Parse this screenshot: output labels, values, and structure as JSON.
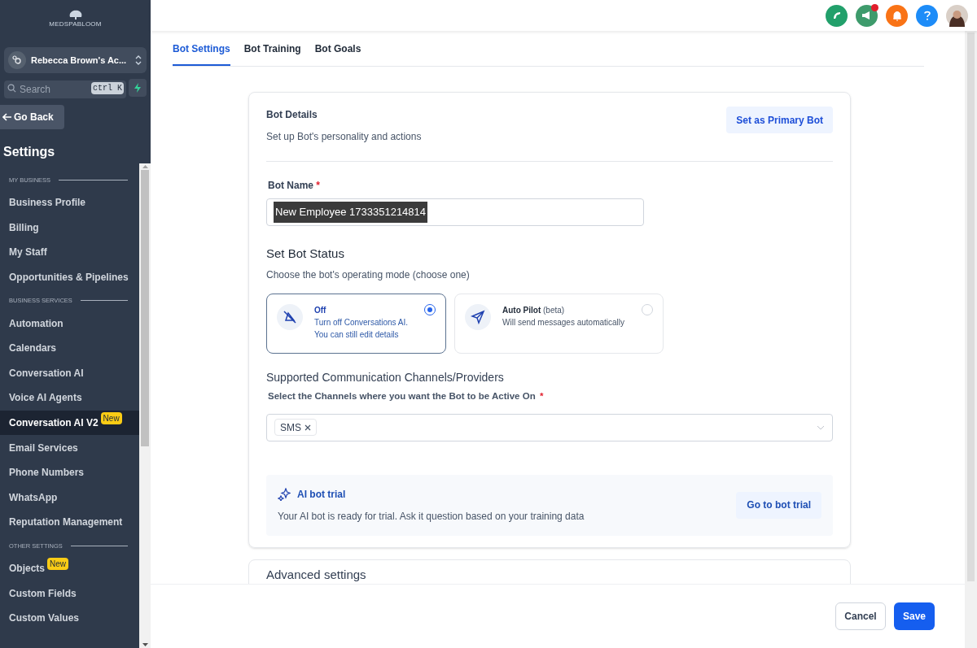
{
  "sidebar": {
    "logo": "MEDSPABLOOM",
    "account": "Rebecca Brown's Ac...",
    "search": {
      "placeholder": "Search",
      "shortcut": "ctrl K"
    },
    "back": "Go Back",
    "title": "Settings",
    "items": [
      {
        "kind": "section",
        "label": "MY BUSINESS"
      },
      {
        "kind": "item",
        "label": "Business Profile",
        "selected": false
      },
      {
        "kind": "item",
        "label": "Billing",
        "selected": false
      },
      {
        "kind": "item",
        "label": "My Staff",
        "selected": false
      },
      {
        "kind": "item",
        "label": "Opportunities & Pipelines",
        "selected": false
      },
      {
        "kind": "section",
        "label": "BUSINESS SERVICES"
      },
      {
        "kind": "item",
        "label": "Automation",
        "selected": false
      },
      {
        "kind": "item",
        "label": "Calendars",
        "selected": false
      },
      {
        "kind": "item",
        "label": "Conversation AI",
        "selected": false
      },
      {
        "kind": "item",
        "label": "Voice AI Agents",
        "selected": false
      },
      {
        "kind": "item",
        "label": "Conversation AI V2",
        "selected": true,
        "badge": "New"
      },
      {
        "kind": "item",
        "label": "Email Services",
        "selected": false
      },
      {
        "kind": "item",
        "label": "Phone Numbers",
        "selected": false
      },
      {
        "kind": "item",
        "label": "WhatsApp",
        "selected": false
      },
      {
        "kind": "item",
        "label": "Reputation Management",
        "selected": false
      },
      {
        "kind": "section",
        "label": "OTHER SETTINGS"
      },
      {
        "kind": "item",
        "label": "Objects",
        "selected": false,
        "badge": "New"
      },
      {
        "kind": "item",
        "label": "Custom Fields",
        "selected": false
      },
      {
        "kind": "item",
        "label": "Custom Values",
        "selected": false
      }
    ]
  },
  "tabs": [
    {
      "label": "Bot Settings",
      "selected": true
    },
    {
      "label": "Bot Training",
      "selected": false
    },
    {
      "label": "Bot Goals",
      "selected": false
    }
  ],
  "details": {
    "title": "Bot Details",
    "subtitle": "Set up Bot's personality and actions",
    "primary_button": "Set as Primary Bot"
  },
  "bot_name": {
    "label": "Bot Name",
    "required": "*",
    "value": "New Employee 1733351214814"
  },
  "status": {
    "title": "Set Bot Status",
    "subtitle": "Choose the bot's operating mode (choose one)",
    "options": [
      {
        "title": "Off",
        "lines": [
          "Turn off Conversations AI.",
          "You can still edit details"
        ],
        "selected": true
      },
      {
        "title": "Auto Pilot",
        "note": "(beta)",
        "lines": [
          "Will send messages automatically"
        ],
        "selected": false
      }
    ]
  },
  "channels": {
    "title": "Supported Communication Channels/Providers",
    "label": "Select the Channels where you want the Bot to be Active On",
    "required": "*",
    "tags": [
      "SMS"
    ]
  },
  "trial": {
    "title": "AI bot trial",
    "text": "Your AI bot is ready for trial. Ask it question based on your training data",
    "button": "Go to bot trial"
  },
  "advanced": "Advanced settings",
  "footer": {
    "cancel": "Cancel",
    "save": "Save"
  }
}
